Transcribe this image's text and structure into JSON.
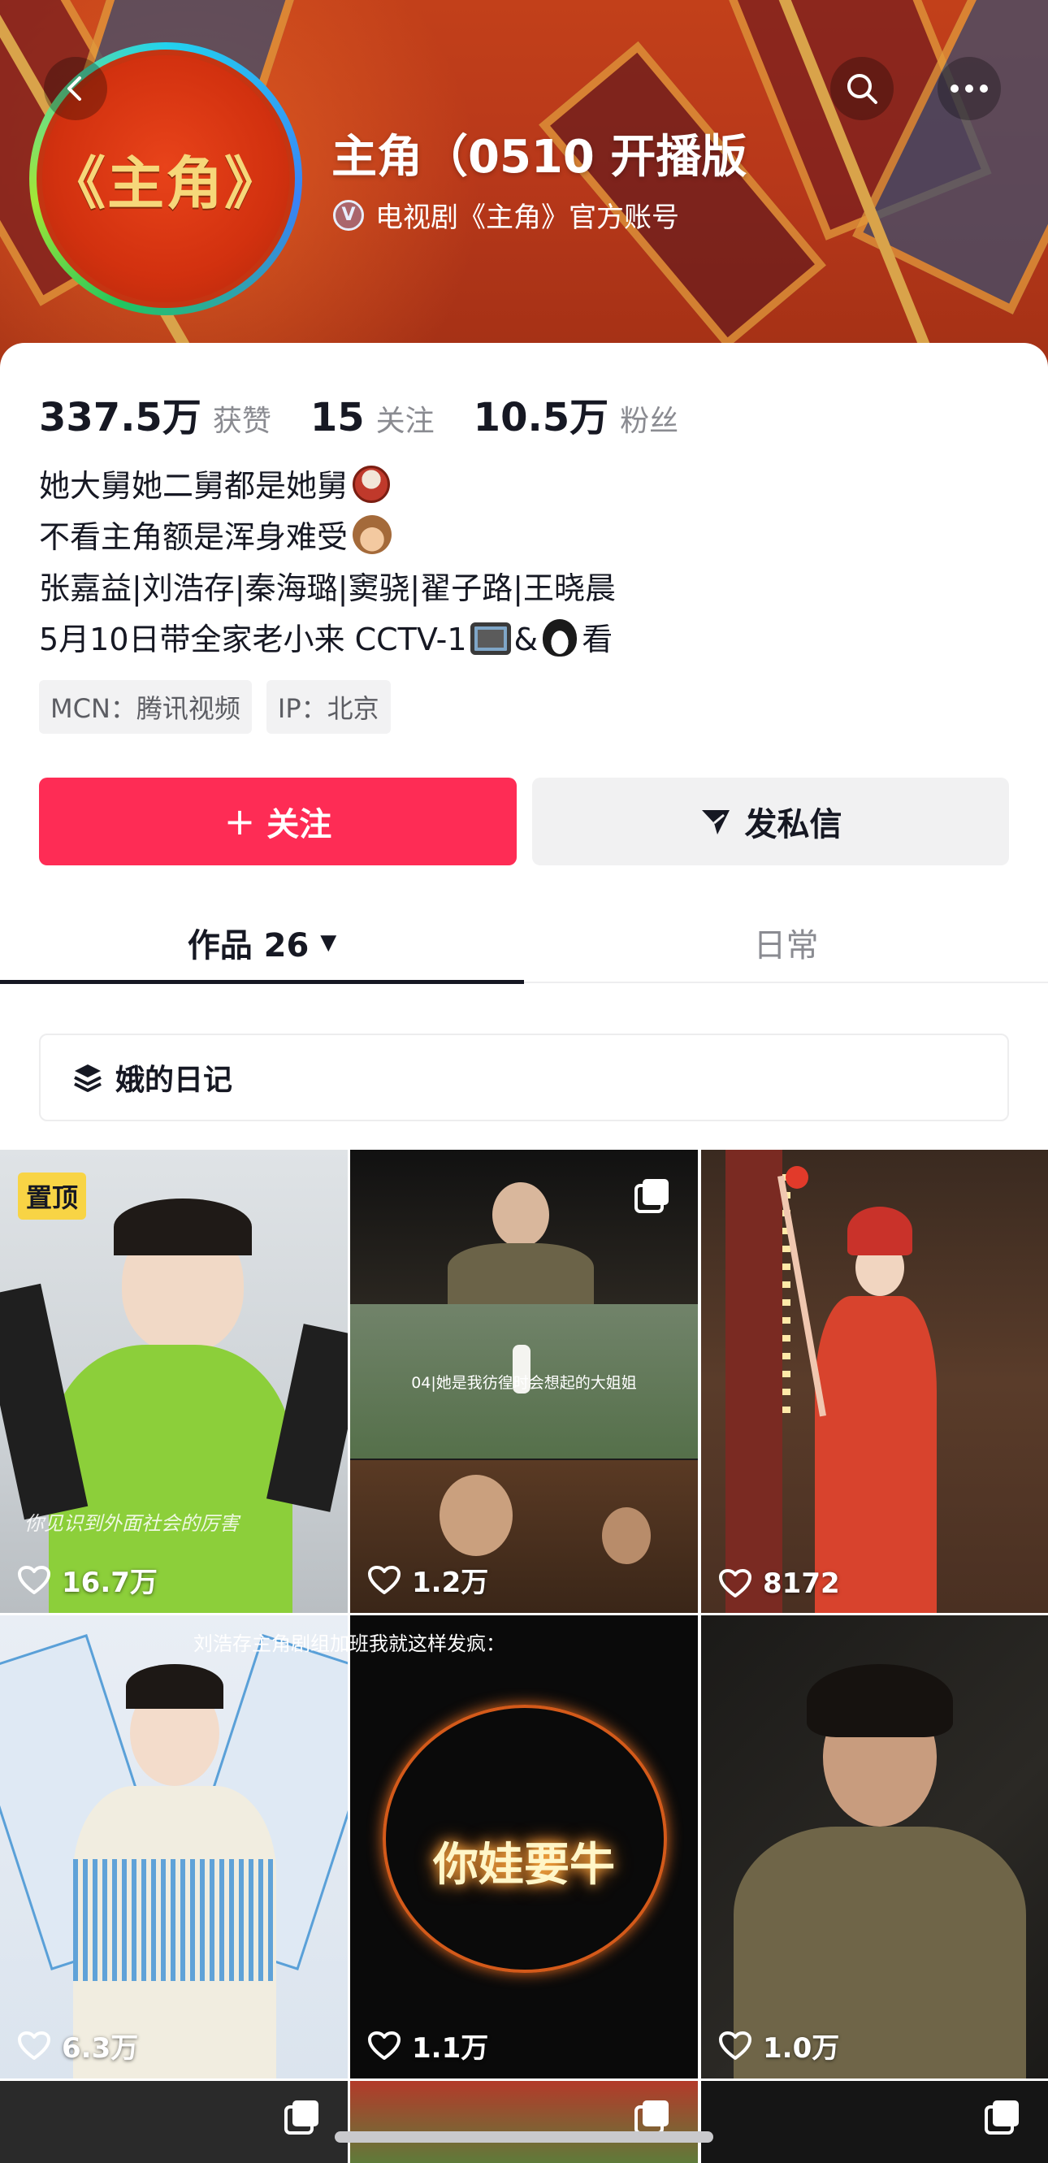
{
  "header": {
    "avatar_text": "《主角》",
    "name": "主角（0510 开播版",
    "verify_badge": "V",
    "verify_text": "电视剧《主角》官方账号",
    "icons": [
      "back-icon",
      "search-icon",
      "more-icon"
    ]
  },
  "stats": [
    {
      "value": "337.5万",
      "label": "获赞"
    },
    {
      "value": "15",
      "label": "关注"
    },
    {
      "value": "10.5万",
      "label": "粉丝"
    }
  ],
  "bio": {
    "line1": "她大舅她二舅都是她舅",
    "line2": "不看主角额是浑身难受",
    "line3": "张嘉益|刘浩存|秦海璐|窦骁|翟子路|王晓晨",
    "line4_a": "5月10日带全家老小来 CCTV-1",
    "line4_b": "&",
    "line4_c": "看"
  },
  "tags": [
    "MCN：腾讯视频",
    "IP：北京"
  ],
  "actions": {
    "follow_plus": "+",
    "follow": "关注",
    "message": "发私信"
  },
  "tabs": {
    "works": "作品 26",
    "works_caret": "▼",
    "daily": "日常"
  },
  "collection": {
    "label": "娥的日记"
  },
  "videos": [
    {
      "likes": "16.7万",
      "pinned": "置顶",
      "caption": "你见识到外面社会的厉害"
    },
    {
      "likes": "1.2万",
      "multi": true,
      "caption": "04|她是我彷徨时会想起的大姐姐"
    },
    {
      "likes": "8172"
    },
    {
      "likes": "6.3万"
    },
    {
      "likes": "1.1万",
      "glow_text": "你娃要牛"
    },
    {
      "likes": "1.0万"
    }
  ],
  "row2_caption": "刘浩存主角剧组加班我就这样发疯："
}
